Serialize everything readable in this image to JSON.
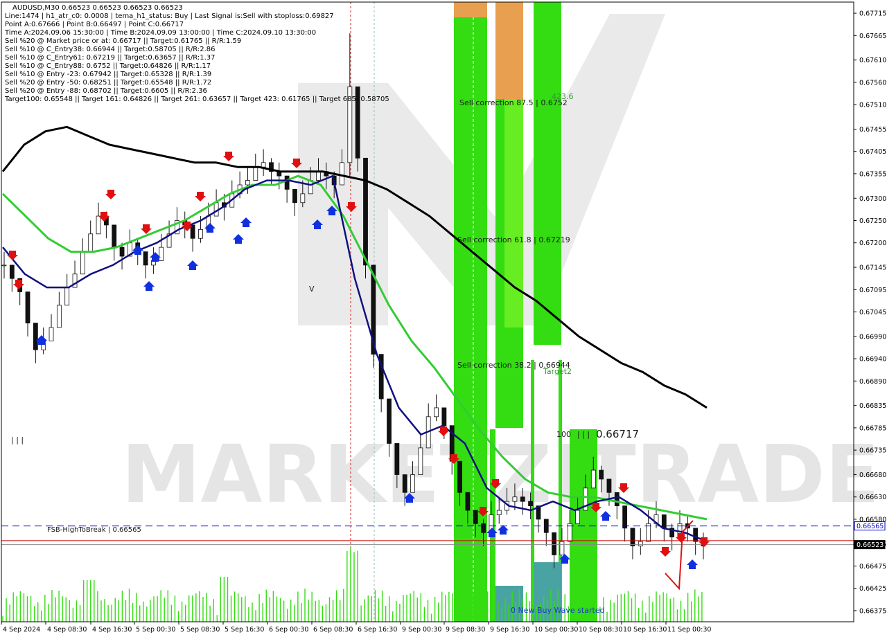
{
  "chart_data": {
    "type": "candlestick",
    "symbol": "AUDUSD,M30",
    "header": "AUDUSD,M30  0.66523 0.66523 0.66523 0.66523",
    "info_lines": [
      "Line:1474 | h1_atr_c0: 0.0008 | tema_h1_status: Buy | Last Signal is:Sell with stoploss:0.69827",
      "Point A:0.67666 | Point B:0.66497 | Point C:0.66717",
      "Time A:2024.09.06 15:30:00 | Time B:2024.09.09 13:00:00 | Time C:2024.09.10 13:30:00",
      "Sell %20 @ Market price or at: 0.66717 || Target:0.61765 || R/R:1.59",
      "Sell %10 @ C_Entry38: 0.66944 || Target:0.58705 || R/R:2.86",
      "Sell %10 @ C_Entry61: 0.67219 || Target:0.63657 || R/R:1.37",
      "Sell %10 @ C_Entry88: 0.6752 || Target:0.64826 || R/R:1.17",
      "Sell %10 @ Entry -23: 0.67942 || Target:0.65328 || R/R:1.39",
      "Sell %20 @ Entry -50: 0.68251 || Target:0.65548 || R/R:1.72",
      "Sell %20 @ Entry -88: 0.68702 || Target:0.6605 || R/R:2.36",
      "Target100: 0.65548 || Target 161: 0.64826 || Target 261: 0.63657 || Target 423: 0.61765 || Target 685: 0.58705"
    ],
    "y_ticks": [
      "0.67715",
      "0.67665",
      "0.67610",
      "0.67560",
      "0.67510",
      "0.67455",
      "0.67405",
      "0.67355",
      "0.67300",
      "0.67250",
      "0.67200",
      "0.67145",
      "0.67095",
      "0.67045",
      "0.66990",
      "0.66940",
      "0.66890",
      "0.66835",
      "0.66785",
      "0.66735",
      "0.66680",
      "0.66630",
      "0.66580",
      "0.66525",
      "0.66475",
      "0.66425",
      "0.66375"
    ],
    "x_ticks": [
      "4 Sep 2024",
      "4 Sep 08:30",
      "4 Sep 16:30",
      "5 Sep 00:30",
      "5 Sep 08:30",
      "5 Sep 16:30",
      "6 Sep 00:30",
      "6 Sep 08:30",
      "6 Sep 16:30",
      "9 Sep 00:30",
      "9 Sep 08:30",
      "9 Sep 16:30",
      "10 Sep 00:30",
      "10 Sep 08:30",
      "10 Sep 16:30",
      "11 Sep 00:30"
    ],
    "ylim": [
      0.6635,
      0.6774
    ],
    "closes": [
      0.6715,
      0.6712,
      0.6709,
      0.6702,
      0.6696,
      0.6698,
      0.6701,
      0.6706,
      0.671,
      0.6713,
      0.6718,
      0.6722,
      0.6726,
      0.6724,
      0.6719,
      0.6717,
      0.672,
      0.6718,
      0.6715,
      0.6716,
      0.6719,
      0.6722,
      0.6725,
      0.6724,
      0.6721,
      0.6723,
      0.6726,
      0.6729,
      0.6728,
      0.6731,
      0.6733,
      0.6734,
      0.6737,
      0.6738,
      0.6736,
      0.6735,
      0.6732,
      0.6729,
      0.6731,
      0.6734,
      0.6736,
      0.6735,
      0.6733,
      0.6738,
      0.6755,
      0.6739,
      0.6715,
      0.6695,
      0.6685,
      0.6675,
      0.6668,
      0.6664,
      0.6668,
      0.6674,
      0.6681,
      0.6683,
      0.6679,
      0.6671,
      0.6664,
      0.666,
      0.6657,
      0.6655,
      0.6659,
      0.666,
      0.6662,
      0.6663,
      0.6662,
      0.6661,
      0.6658,
      0.6655,
      0.665,
      0.6653,
      0.6657,
      0.666,
      0.6665,
      0.6669,
      0.6667,
      0.6664,
      0.6661,
      0.6656,
      0.6652,
      0.6653,
      0.6657,
      0.6659,
      0.6656,
      0.6654,
      0.6657,
      0.6656,
      0.6653,
      0.6652
    ],
    "highs": [
      0.6718,
      0.6715,
      0.6712,
      0.6705,
      0.6699,
      0.6701,
      0.6704,
      0.6709,
      0.6713,
      0.6716,
      0.6721,
      0.6725,
      0.6729,
      0.6727,
      0.6722,
      0.672,
      0.6723,
      0.6721,
      0.6718,
      0.6719,
      0.6722,
      0.6725,
      0.6728,
      0.6727,
      0.6724,
      0.6726,
      0.6729,
      0.6732,
      0.6731,
      0.6734,
      0.6736,
      0.6737,
      0.674,
      0.6741,
      0.6739,
      0.6738,
      0.6735,
      0.6732,
      0.6734,
      0.6737,
      0.6739,
      0.6738,
      0.6736,
      0.6741,
      0.6767,
      0.6742,
      0.6718,
      0.6698,
      0.6688,
      0.6678,
      0.6671,
      0.6667,
      0.6671,
      0.6677,
      0.6684,
      0.6686,
      0.6682,
      0.6674,
      0.6667,
      0.6663,
      0.666,
      0.6658,
      0.6662,
      0.6663,
      0.6665,
      0.6666,
      0.6665,
      0.6664,
      0.6661,
      0.6658,
      0.6653,
      0.6656,
      0.666,
      0.6663,
      0.6668,
      0.6672,
      0.667,
      0.6667,
      0.6664,
      0.6659,
      0.6655,
      0.6656,
      0.666,
      0.6662,
      0.6659,
      0.6657,
      0.666,
      0.6659,
      0.6656,
      0.6655
    ],
    "lows": [
      0.6712,
      0.6709,
      0.6706,
      0.6699,
      0.6693,
      0.6695,
      0.6698,
      0.6703,
      0.6707,
      0.671,
      0.6715,
      0.6719,
      0.6723,
      0.6721,
      0.6716,
      0.6714,
      0.6717,
      0.6715,
      0.6712,
      0.6713,
      0.6716,
      0.6719,
      0.6722,
      0.6721,
      0.6718,
      0.672,
      0.6723,
      0.6726,
      0.6725,
      0.6728,
      0.673,
      0.6731,
      0.6734,
      0.6735,
      0.6733,
      0.6732,
      0.6729,
      0.6726,
      0.6728,
      0.6731,
      0.6733,
      0.6732,
      0.673,
      0.6735,
      0.6735,
      0.6736,
      0.6712,
      0.6692,
      0.6682,
      0.6672,
      0.6665,
      0.6661,
      0.6665,
      0.6671,
      0.6678,
      0.668,
      0.6676,
      0.6668,
      0.6661,
      0.6657,
      0.6654,
      0.6652,
      0.6656,
      0.6657,
      0.6659,
      0.666,
      0.6659,
      0.6658,
      0.6655,
      0.6652,
      0.6647,
      0.665,
      0.6654,
      0.6657,
      0.6662,
      0.6666,
      0.6664,
      0.6661,
      0.6658,
      0.6653,
      0.6649,
      0.665,
      0.6654,
      0.6656,
      0.6653,
      0.6651,
      0.6654,
      0.6653,
      0.665,
      0.6649
    ],
    "ma_black": [
      0.6736,
      0.6742,
      0.6745,
      0.6746,
      0.6744,
      0.6742,
      0.6741,
      0.674,
      0.6739,
      0.6738,
      0.6738,
      0.6737,
      0.6737,
      0.6736,
      0.6736,
      0.6736,
      0.6735,
      0.6734,
      0.6732,
      0.6729,
      0.6726,
      0.6722,
      0.6718,
      0.6714,
      0.671,
      0.6707,
      0.6703,
      0.6699,
      0.6696,
      0.6693,
      0.6691,
      0.6688,
      0.6686,
      0.6683
    ],
    "ma_green": [
      0.6731,
      0.6726,
      0.6721,
      0.6718,
      0.6718,
      0.6719,
      0.6721,
      0.6723,
      0.6725,
      0.6728,
      0.6731,
      0.6733,
      0.6733,
      0.6735,
      0.6733,
      0.6726,
      0.6716,
      0.6706,
      0.6698,
      0.6692,
      0.6685,
      0.6678,
      0.6672,
      0.6667,
      0.6664,
      0.6663,
      0.6663,
      0.6662,
      0.6661,
      0.666,
      0.6659,
      0.6658
    ],
    "ma_navy": [
      0.6719,
      0.6713,
      0.671,
      0.671,
      0.6713,
      0.6715,
      0.6718,
      0.672,
      0.6723,
      0.6725,
      0.6728,
      0.6732,
      0.6734,
      0.6734,
      0.6733,
      0.6735,
      0.6712,
      0.6695,
      0.6683,
      0.6677,
      0.6679,
      0.6675,
      0.6665,
      0.6661,
      0.666,
      0.6662,
      0.666,
      0.6662,
      0.6663,
      0.666,
      0.6656,
      0.6655,
      0.6653
    ],
    "levels": {
      "fsb": {
        "label": "FSB-HighToBreak | 0.66565",
        "value": 0.66565,
        "tag": "0.66565",
        "color": "#0000cc"
      },
      "bid": {
        "value": 0.66523,
        "tag": "0.66523",
        "color": "#000000"
      },
      "red": {
        "value": 0.66532,
        "color": "#cc0000"
      }
    },
    "zone_labels": {
      "sell_87": "Sell correction 87.5 | 0.6752",
      "sell_61": "Sell correction 61.8 | 0.67219",
      "sell_38": "Sell correction 38.2 | 0.66944",
      "t423": "423.6",
      "target2": "Target2",
      "t100": "100",
      "c_marks": "| | |",
      "c_price": "0.66717",
      "buy_wave": "0 New Buy Wave started",
      "left_marks": "| | |",
      "v_mark": "V"
    },
    "watermark": "MARKETZITRADE",
    "colors": {
      "bright_green": "#33dd11",
      "lime": "#66ee22",
      "orange": "#e8a050",
      "teal": "#4aa3a3",
      "bull": "#26a69a",
      "bear": "#111111",
      "ma_green": "#33cc33",
      "ma_navy": "#101080",
      "ma_black": "#000000"
    }
  }
}
